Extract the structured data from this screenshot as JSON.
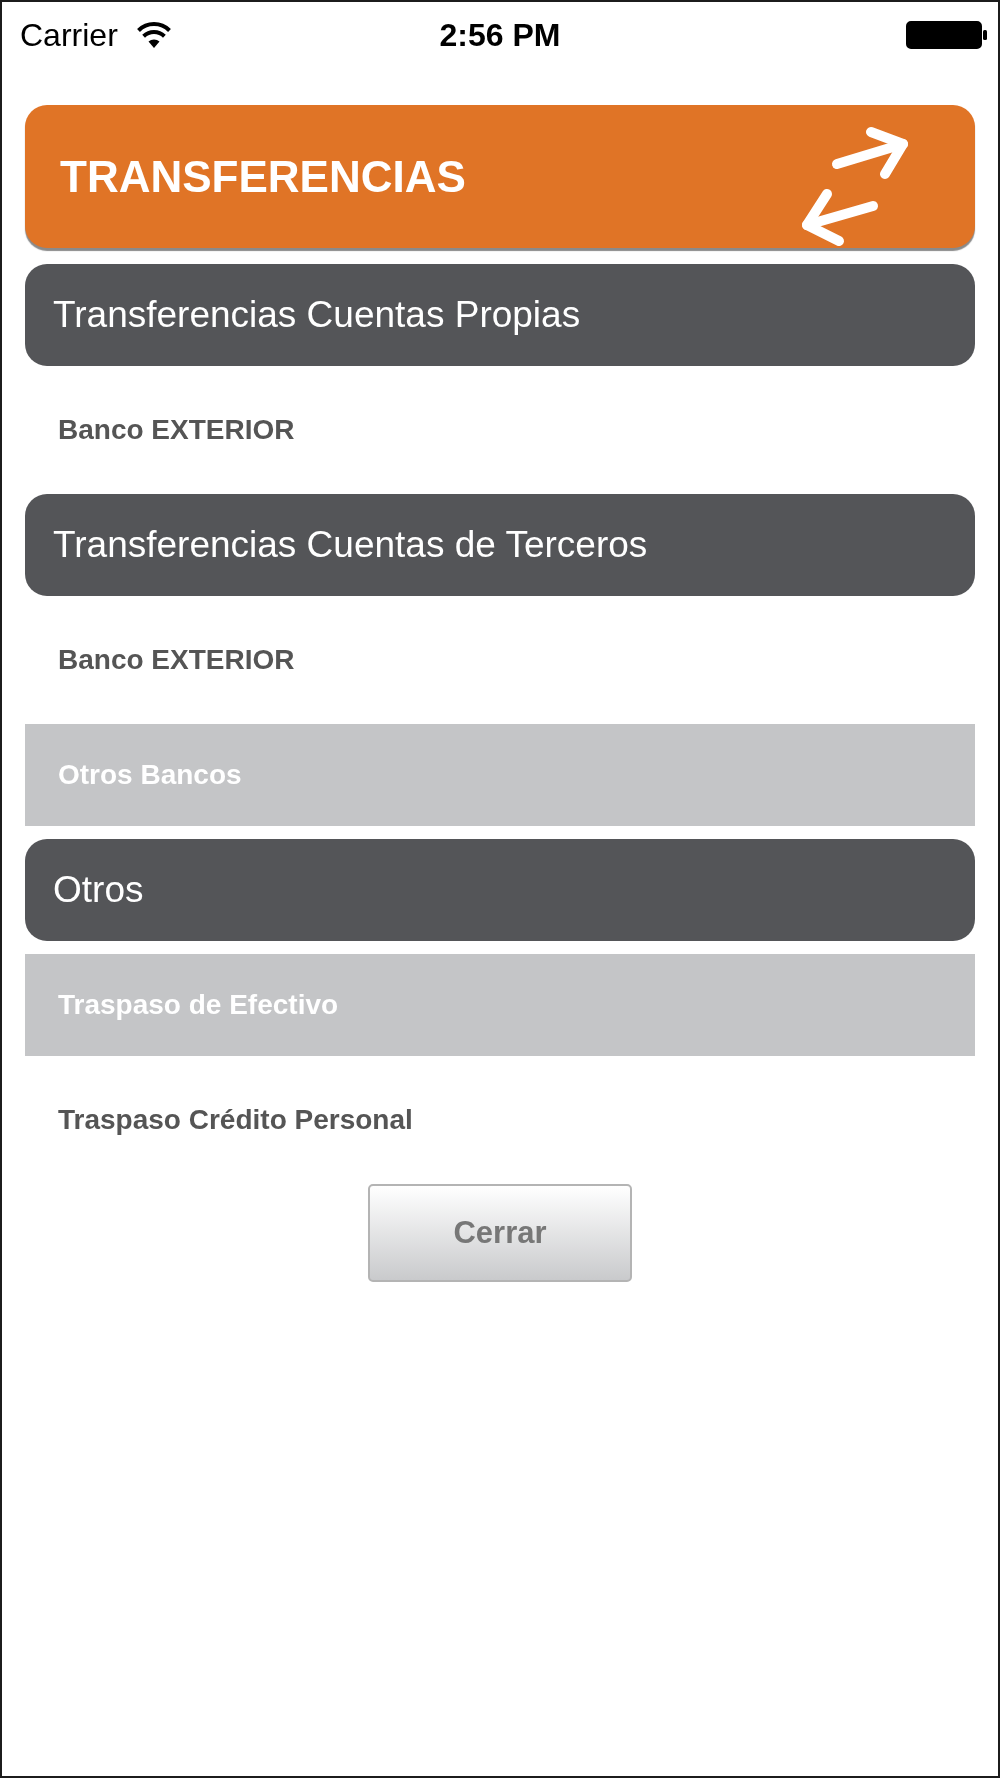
{
  "status_bar": {
    "carrier": "Carrier",
    "time": "2:56 PM"
  },
  "header": {
    "title": "TRANSFERENCIAS"
  },
  "sections": [
    {
      "title": "Transferencias Cuentas Propias",
      "items": [
        {
          "label": "Banco EXTERIOR",
          "disabled": false
        }
      ]
    },
    {
      "title": "Transferencias Cuentas de Terceros",
      "items": [
        {
          "label": "Banco EXTERIOR",
          "disabled": false
        },
        {
          "label": "Otros Bancos",
          "disabled": true
        }
      ]
    },
    {
      "title": "Otros",
      "items": [
        {
          "label": "Traspaso de Efectivo",
          "disabled": true
        },
        {
          "label": "Traspaso Crédito Personal",
          "disabled": false
        }
      ]
    }
  ],
  "close_button": {
    "label": "Cerrar"
  }
}
